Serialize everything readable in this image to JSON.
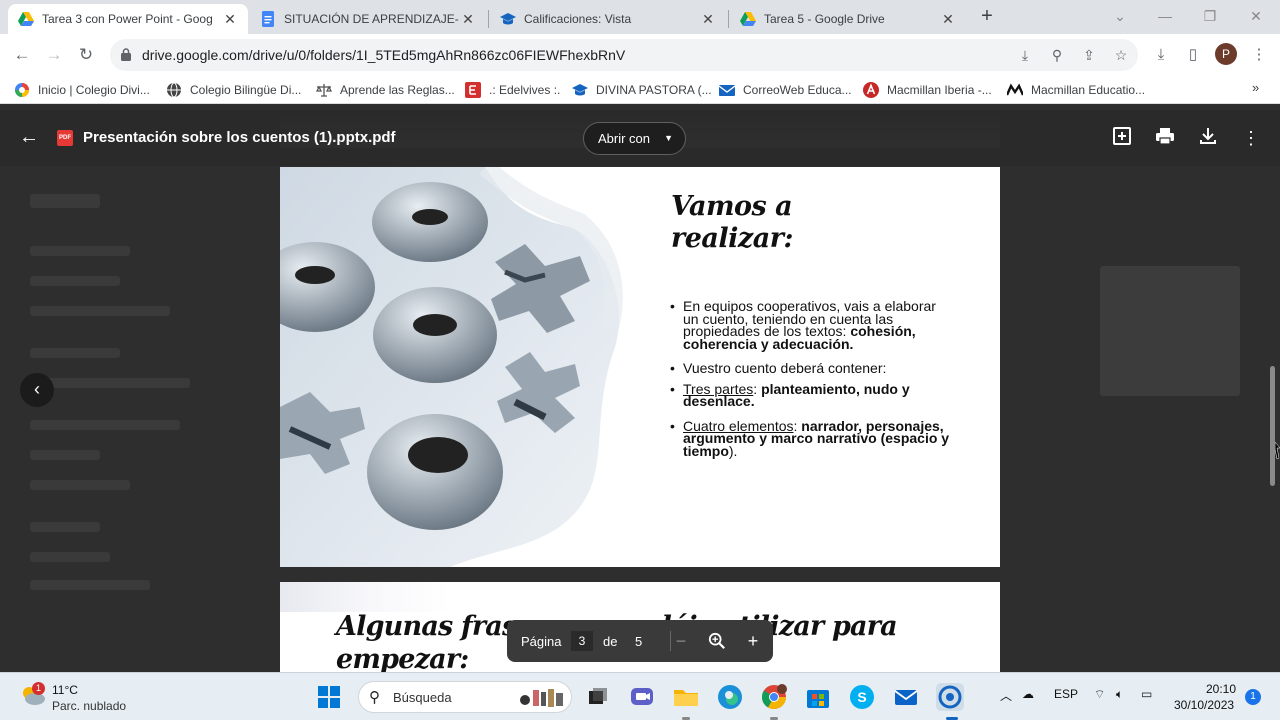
{
  "browser": {
    "tabs": [
      {
        "title": "Tarea 3 con Power Point - Goog",
        "icon": "google-drive-icon",
        "active": true
      },
      {
        "title": "SITUACIÓN DE APRENDIZAJE- (",
        "icon": "google-docs-icon",
        "active": false
      },
      {
        "title": "Calificaciones: Vista",
        "icon": "graduation-cap-icon",
        "active": false
      },
      {
        "title": "Tarea 5 - Google Drive",
        "icon": "google-drive-icon",
        "active": false
      }
    ],
    "url": "drive.google.com/drive/u/0/folders/1I_5TEd5mgAhRn866zc06FIEWFhexbRnV",
    "profile_initial": "P",
    "bookmarks": [
      {
        "label": "Inicio | Colegio Divi...",
        "icon": "google-icon"
      },
      {
        "label": "Colegio Bilingüe Di...",
        "icon": "globe-icon"
      },
      {
        "label": "Aprende las Reglas...",
        "icon": "rules-icon"
      },
      {
        "label": ".: Edelvives :.",
        "icon": "edelvives-icon"
      },
      {
        "label": "DIVINA PASTORA (...",
        "icon": "graduation-cap-icon"
      },
      {
        "label": "CorreoWeb Educa...",
        "icon": "mail-icon"
      },
      {
        "label": "Macmillan Iberia -...",
        "icon": "macmillan-a-icon"
      },
      {
        "label": "Macmillan Educatio...",
        "icon": "macmillan-m-icon"
      }
    ],
    "bookmarks_more": "»"
  },
  "viewer": {
    "file_title": "Presentación sobre los cuentos (1).pptx.pdf",
    "file_badge": "PDF",
    "open_with_label": "Abrir con",
    "page_label": "Página",
    "page_current": "3",
    "page_of": "de",
    "page_total": "5"
  },
  "slide3": {
    "title_line1": "Vamos a",
    "title_line2": "realizar:",
    "b1_text": "En equipos cooperativos, vais a elaborar un cuento, teniendo en cuenta las propiedades de los textos: ",
    "b1_bold": "cohesión, coherencia y adecuación.",
    "b2_text": "Vuestro cuento deberá contener:",
    "b3_under": "Tres partes",
    "b3_sep": ": ",
    "b3_bold": "planteamiento, nudo y desenlace.",
    "b4_under": "Cuatro elementos",
    "b4_sep": ": ",
    "b4_bold": "narrador, personajes, argumento y marco narrativo (espacio y tiempo",
    "b4_end": ")."
  },
  "slide4": {
    "title_line1": "Algunas frases que podéis utilizar para",
    "title_line2": "empezar:"
  },
  "taskbar": {
    "weather_temp": "11°C",
    "weather_desc": "Parc. nublado",
    "weather_badge": "1",
    "search_placeholder": "Búsqueda",
    "language": "ESP",
    "time": "20:10",
    "date": "30/10/2023",
    "notifications": "1"
  },
  "colors": {
    "tab_strip": "#dee1e6",
    "viewer_bg": "#2b2b2b",
    "pdf_red": "#e53935",
    "taskbar": "#e7eef3"
  }
}
